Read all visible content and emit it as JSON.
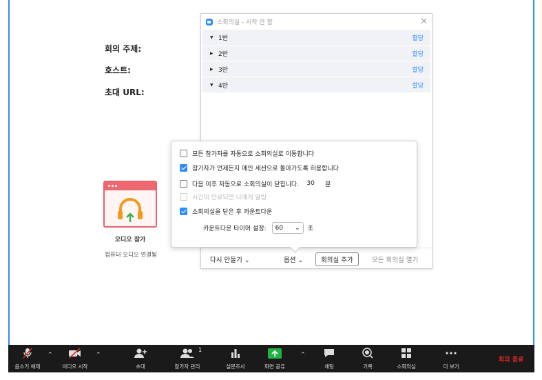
{
  "meeting_info": {
    "topic_label": "회의 주제:",
    "host_label": "호스트:",
    "url_label": "초대 URL:"
  },
  "audio": {
    "title": "오디오 참가",
    "subtitle": "컴퓨터 오디오 연결됨",
    "icon": "headphones-upload-icon"
  },
  "breakout_window": {
    "title": "소회의실 - 시작 안 함",
    "rooms": [
      {
        "name": "1반",
        "assign_label": "할당"
      },
      {
        "name": "2반",
        "assign_label": "할당"
      },
      {
        "name": "3반",
        "assign_label": "할당"
      },
      {
        "name": "4반",
        "assign_label": "할당"
      }
    ],
    "footer": {
      "recreate_label": "다시 만들기 ⌄",
      "options_label": "옵션 ⌄",
      "add_room_label": "회의실 추가",
      "open_all_label": "모든 회의실 열기"
    }
  },
  "options_popup": {
    "auto_move": {
      "label": "모든 참가자를 자동으로 소회의실로 이동합니다",
      "checked": false
    },
    "allow_return": {
      "label": "참가자가 언제든지 메인 세션으로 돌아가도록 허용합니다",
      "checked": true
    },
    "auto_close": {
      "label": "다음 이후 자동으로 소회의실이 닫힙니다.",
      "minutes": "30",
      "unit": "분",
      "checked": false
    },
    "notify_end": {
      "label": "시간이 만료되면 나에게 알림",
      "checked": false,
      "disabled": true
    },
    "countdown": {
      "label": "소회의실을 닫은 후 카운트다운",
      "checked": true
    },
    "countdown_timer": {
      "label": "카운트다운 타이머 설정:",
      "value": "60",
      "unit": "초"
    }
  },
  "toolbar": {
    "mute": "음소거 해제",
    "video": "비디오 시작",
    "invite": "초대",
    "participants": "참가자 관리",
    "participants_count": "1",
    "polls": "설문조사",
    "share": "화면 공유",
    "chat": "채팅",
    "record": "기록",
    "breakout": "소회의실",
    "more": "더 보기",
    "end": "회의 종료"
  },
  "colors": {
    "accent": "#2D8CFF",
    "share_green": "#1fb141",
    "end_red": "#e02828",
    "audio_card": "#ee6871"
  }
}
